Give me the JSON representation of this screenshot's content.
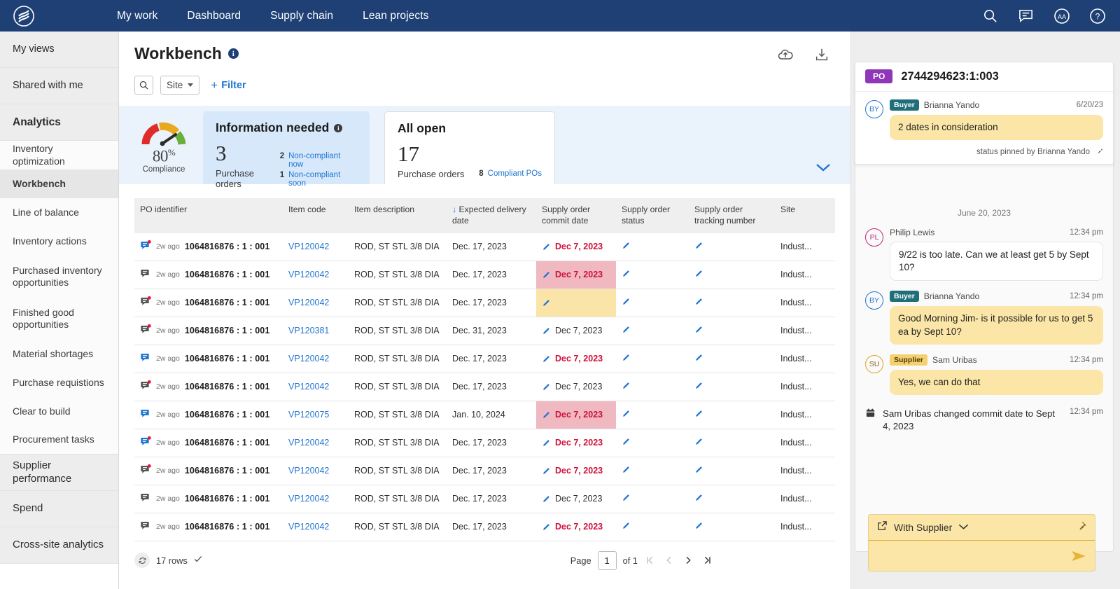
{
  "topnav": {
    "logo_name": "brand-logo",
    "links": [
      "My work",
      "Dashboard",
      "Supply chain",
      "Lean projects"
    ],
    "icons": [
      "search-icon",
      "chat-icon",
      "accessibility-icon",
      "help-icon"
    ]
  },
  "sidebar": {
    "groups": [
      {
        "label": "My views",
        "type": "group"
      },
      {
        "label": "Shared with me",
        "type": "group"
      },
      {
        "label": "Analytics",
        "type": "header"
      }
    ],
    "analytics_items": [
      {
        "label": "Inventory optimization",
        "active": false
      },
      {
        "label": "Workbench",
        "active": true
      },
      {
        "label": "Line of balance",
        "active": false
      },
      {
        "label": "Inventory actions",
        "active": false
      },
      {
        "label": "Purchased inventory opportunities",
        "active": false
      },
      {
        "label": "Finished good opportunities",
        "active": false
      },
      {
        "label": "Material shortages",
        "active": false
      },
      {
        "label": "Purchase requistions",
        "active": false
      },
      {
        "label": "Clear to build",
        "active": false
      },
      {
        "label": "Procurement tasks",
        "active": false
      }
    ],
    "bottom_groups": [
      {
        "label": "Supplier performance"
      },
      {
        "label": "Spend"
      },
      {
        "label": "Cross-site analytics"
      }
    ]
  },
  "header": {
    "title": "Workbench",
    "info_char": "i",
    "upload_icon": "cloud-upload-icon",
    "download_icon": "download-icon"
  },
  "filters": {
    "search_icon": "search-icon",
    "site_label": "Site",
    "add_filter_label": "Filter",
    "add_filter_plus": "+"
  },
  "kpi": {
    "gauge": {
      "value": "80",
      "unit": "%",
      "label": "Compliance"
    },
    "cards": [
      {
        "title": "Information needed",
        "info_char": "i",
        "number": "3",
        "sub": "Purchase orders",
        "links": [
          {
            "count": "2",
            "label": "Non-compliant now"
          },
          {
            "count": "1",
            "label": "Non-compliant soon"
          }
        ],
        "selected": true
      },
      {
        "title": "All open",
        "number": "17",
        "sub": "Purchase orders",
        "links": [
          {
            "count": "8",
            "label": "Compliant POs"
          }
        ],
        "selected": false
      }
    ],
    "expand_icon": "chevron-down-icon"
  },
  "table": {
    "columns": [
      "PO identifier",
      "Item code",
      "Item description",
      "Expected delivery date",
      "Supply order commit date",
      "Supply order status",
      "Supply order tracking number",
      "Site"
    ],
    "sort_column_index": 3,
    "sort_arrow": "↓",
    "rows": [
      {
        "icon": "chat-blue-alert",
        "ago": "2w ago",
        "po": "1064816876 : 1 : 001",
        "item": "VP120042",
        "desc": "ROD, ST STL 3/8 DIA",
        "expected": "Dec. 17, 2023",
        "commit": "Dec 7, 2023",
        "commit_style": "red",
        "commit_hl": "none",
        "site": "Indust..."
      },
      {
        "icon": "chat-gray",
        "ago": "2w ago",
        "po": "1064816876 : 1 : 001",
        "item": "VP120042",
        "desc": "ROD, ST STL 3/8 DIA",
        "expected": "Dec. 17, 2023",
        "commit": "Dec 7, 2023",
        "commit_style": "red",
        "commit_hl": "pink",
        "site": "Indust..."
      },
      {
        "icon": "chat-gray-alert",
        "ago": "2w ago",
        "po": "1064816876 : 1 : 001",
        "item": "VP120042",
        "desc": "ROD, ST STL 3/8 DIA",
        "expected": "Dec. 17, 2023",
        "commit": "",
        "commit_style": "dark",
        "commit_hl": "yellow",
        "site": "Indust..."
      },
      {
        "icon": "chat-gray-alert",
        "ago": "2w ago",
        "po": "1064816876 : 1 : 001",
        "item": "VP120381",
        "desc": "ROD, ST STL 3/8 DIA",
        "expected": "Dec. 31, 2023",
        "commit": "Dec 7, 2023",
        "commit_style": "dark",
        "commit_hl": "none",
        "site": "Indust..."
      },
      {
        "icon": "chat-blue",
        "ago": "2w ago",
        "po": "1064816876 : 1 : 001",
        "item": "VP120042",
        "desc": "ROD, ST STL 3/8 DIA",
        "expected": "Dec. 17, 2023",
        "commit": "Dec 7, 2023",
        "commit_style": "red",
        "commit_hl": "none",
        "site": "Indust..."
      },
      {
        "icon": "chat-gray-alert",
        "ago": "2w ago",
        "po": "1064816876 : 1 : 001",
        "item": "VP120042",
        "desc": "ROD, ST STL 3/8 DIA",
        "expected": "Dec. 17, 2023",
        "commit": "Dec 7, 2023",
        "commit_style": "dark",
        "commit_hl": "none",
        "site": "Indust..."
      },
      {
        "icon": "chat-blue",
        "ago": "2w ago",
        "po": "1064816876 : 1 : 001",
        "item": "VP120075",
        "desc": "ROD, ST STL 3/8 DIA",
        "expected": "Jan. 10, 2024",
        "commit": "Dec 7, 2023",
        "commit_style": "red",
        "commit_hl": "pink",
        "site": "Indust..."
      },
      {
        "icon": "chat-blue-alert",
        "ago": "2w ago",
        "po": "1064816876 : 1 : 001",
        "item": "VP120042",
        "desc": "ROD, ST STL 3/8 DIA",
        "expected": "Dec. 17, 2023",
        "commit": "Dec 7, 2023",
        "commit_style": "red",
        "commit_hl": "none",
        "site": "Indust..."
      },
      {
        "icon": "chat-gray-alert",
        "ago": "2w ago",
        "po": "1064816876 : 1 : 001",
        "item": "VP120042",
        "desc": "ROD, ST STL 3/8 DIA",
        "expected": "Dec. 17, 2023",
        "commit": "Dec 7, 2023",
        "commit_style": "red",
        "commit_hl": "none",
        "site": "Indust..."
      },
      {
        "icon": "chat-gray",
        "ago": "2w ago",
        "po": "1064816876 : 1 : 001",
        "item": "VP120042",
        "desc": "ROD, ST STL 3/8 DIA",
        "expected": "Dec. 17, 2023",
        "commit": "Dec 7, 2023",
        "commit_style": "dark",
        "commit_hl": "none",
        "site": "Indust..."
      },
      {
        "icon": "chat-gray",
        "ago": "2w ago",
        "po": "1064816876 : 1 : 001",
        "item": "VP120042",
        "desc": "ROD, ST STL 3/8 DIA",
        "expected": "Dec. 17, 2023",
        "commit": "Dec 7, 2023",
        "commit_style": "red",
        "commit_hl": "none",
        "site": "Indust..."
      }
    ],
    "footer": {
      "refresh_icon": "refresh-icon",
      "rows_label": "17 rows",
      "check_icon": "check-icon",
      "page_label": "Page",
      "page_value": "1",
      "of_label": "of 1",
      "first_icon": "first-page-icon",
      "prev_icon": "prev-page-icon",
      "next_icon": "next-page-icon",
      "last_icon": "last-page-icon"
    }
  },
  "right_panel": {
    "pinned": {
      "badge": "PO",
      "title": "2744294623:1:003",
      "avatar": "BY",
      "role": "Buyer",
      "name": "Brianna Yando",
      "time": "6/20/23",
      "text": "2 dates in consideration",
      "footer": "status pinned by Brianna Yando",
      "pin_icon": "pin-icon"
    },
    "date_separator": "June 20, 2023",
    "messages": [
      {
        "avatar": "PL",
        "avatar_style": "pl",
        "role": "",
        "name": "Philip Lewis",
        "time": "12:34 pm",
        "text": "9/22 is too late. Can we at least get 5 by Sept 10?",
        "bubble": "white"
      },
      {
        "avatar": "BY",
        "avatar_style": "by",
        "role": "Buyer",
        "name": "Brianna Yando",
        "time": "12:34 pm",
        "text": "Good Morning Jim- is it possible for us to get 5 ea by Sept 10?",
        "bubble": "yellow"
      },
      {
        "avatar": "SU",
        "avatar_style": "su",
        "role": "Supplier",
        "name": "Sam Uribas",
        "time": "12:34 pm",
        "text": "Yes, we can do that",
        "bubble": "yellow"
      }
    ],
    "system_event": {
      "icon": "calendar-icon",
      "text": "Sam Uribas changed commit date to Sept 4, 2023",
      "time": "12:34 pm"
    },
    "composer": {
      "external_icon": "external-link-icon",
      "label": "With Supplier",
      "chevron_icon": "chevron-down-icon",
      "pin_icon": "pin-outline-icon",
      "send_icon": "send-icon",
      "input_value": "",
      "input_placeholder": ""
    }
  },
  "colors": {
    "nav_bg": "#1f4075",
    "accent_link": "#2176d2",
    "kpi_strip_bg": "#eaf3fc",
    "kpi_selected_bg": "#d6e8fa",
    "alert_red": "#d0103a",
    "highlight_pink": "#f0b8c0",
    "highlight_yellow": "#fae4a8",
    "badge_purple": "#8f37b8",
    "buyer_badge": "#1f6f7a",
    "supplier_badge": "#f4d06f"
  }
}
